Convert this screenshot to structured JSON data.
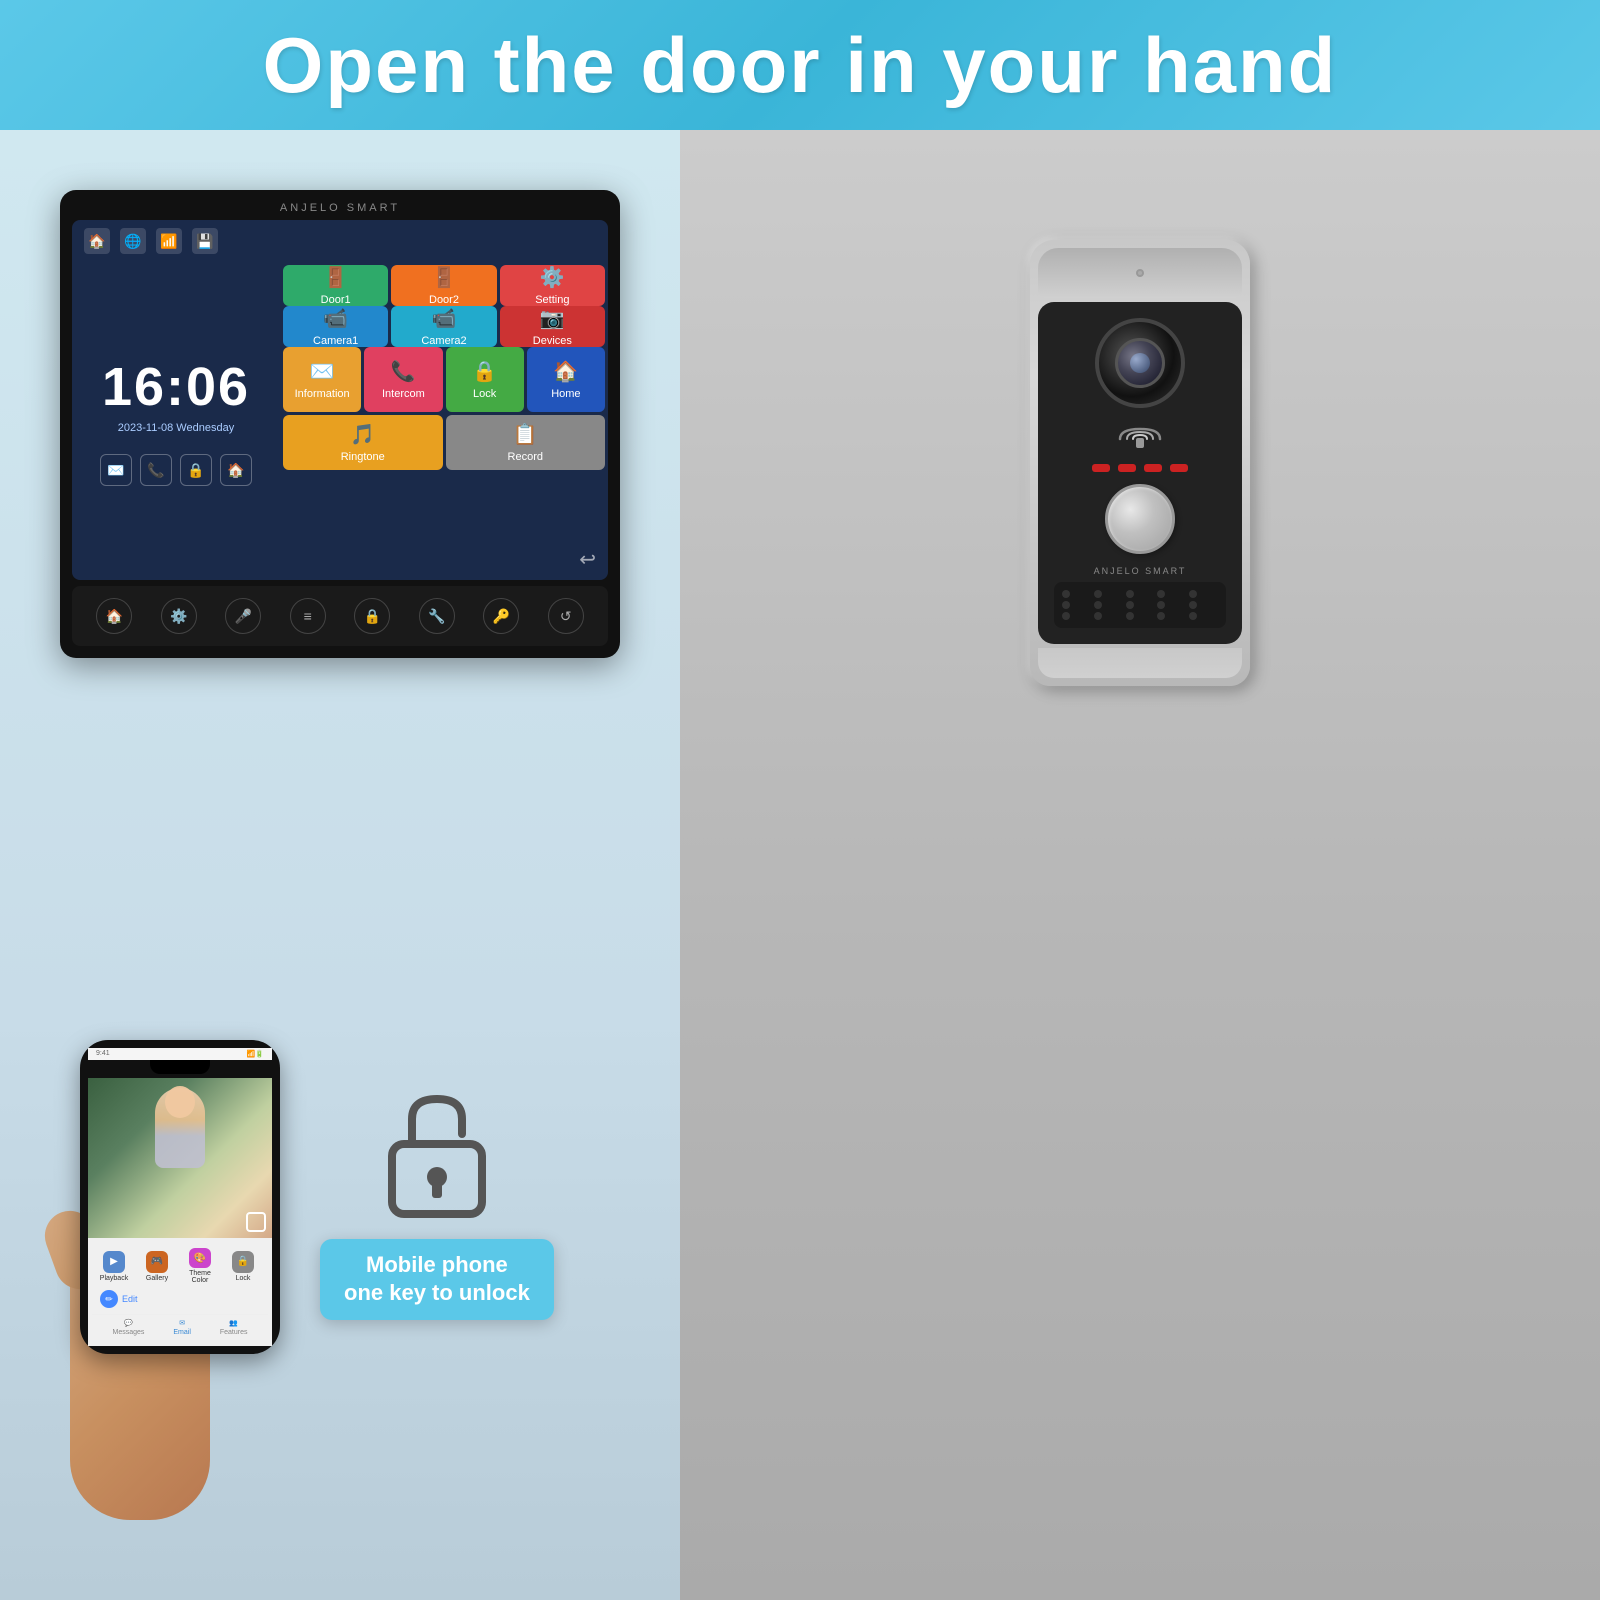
{
  "header": {
    "title": "Open the door in your hand",
    "bg_color": "#5bc8e8"
  },
  "monitor": {
    "brand": "ANJELO SMART",
    "clock": {
      "time": "16:06",
      "date": "2023-11-08 Wednesday"
    },
    "tiles": [
      {
        "id": "door1",
        "label": "Door1",
        "color": "#2eaa6a",
        "icon": "🚪"
      },
      {
        "id": "door2",
        "label": "Door2",
        "color": "#f07020",
        "icon": "🚪"
      },
      {
        "id": "setting",
        "label": "Setting",
        "color": "#e04444",
        "icon": "⚙️"
      },
      {
        "id": "devices",
        "label": "Devices",
        "color": "#cc3333",
        "icon": "📷"
      },
      {
        "id": "camera1",
        "label": "Camera1",
        "color": "#2288cc",
        "icon": "📹"
      },
      {
        "id": "camera2",
        "label": "Camera2",
        "color": "#22aacc",
        "icon": "📹"
      },
      {
        "id": "ringtone",
        "label": "Ringtone",
        "color": "#e8a020",
        "icon": "🎵"
      },
      {
        "id": "record",
        "label": "Record",
        "color": "#888888",
        "icon": "📋"
      },
      {
        "id": "information",
        "label": "Information",
        "color": "#e8a030",
        "icon": "✉️"
      },
      {
        "id": "intercom",
        "label": "Intercom",
        "color": "#e04060",
        "icon": "📞"
      },
      {
        "id": "lock",
        "label": "Lock",
        "color": "#44aa44",
        "icon": "🔒"
      },
      {
        "id": "home",
        "label": "Home",
        "color": "#2255bb",
        "icon": "🏠"
      }
    ]
  },
  "unlock": {
    "badge_line1": "Mobile phone",
    "badge_line2": "one key to unlock"
  },
  "doorbell": {
    "brand": "ANJELO SMART"
  },
  "phone": {
    "status": "9:41",
    "signal": "●●●",
    "apps": [
      {
        "label": "Playback",
        "color": "#555"
      },
      {
        "label": "Gallery",
        "color": "#777"
      },
      {
        "label": "Theme Color",
        "color": "#999"
      },
      {
        "label": "Lock",
        "color": "#555"
      }
    ],
    "tabs": [
      {
        "label": "Messages",
        "active": false
      },
      {
        "label": "Email",
        "active": true
      },
      {
        "label": "Features",
        "active": false
      }
    ],
    "edit_label": "Edit"
  }
}
